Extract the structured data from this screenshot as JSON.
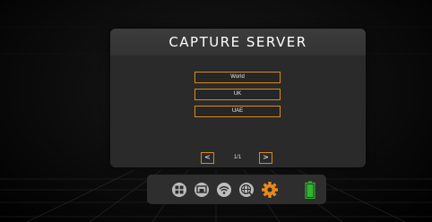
{
  "title": "CAPTURE SERVER",
  "servers": [
    {
      "label": "World"
    },
    {
      "label": "UK"
    },
    {
      "label": "UAE"
    }
  ],
  "pager": {
    "prev_label": "<",
    "next_label": ">",
    "indicator": "1/1"
  },
  "dock": {
    "icons": [
      "grid-icon",
      "screen-icon",
      "wifi-icon",
      "globe-icon",
      "gear-icon",
      "battery-icon"
    ],
    "active_icon": "gear-icon",
    "battery_level": 1.0
  },
  "colors": {
    "accent": "#d98a1e",
    "battery": "#2fb52f",
    "panel": "#2a2a2a",
    "dock_icon": "#bdbdbd"
  }
}
